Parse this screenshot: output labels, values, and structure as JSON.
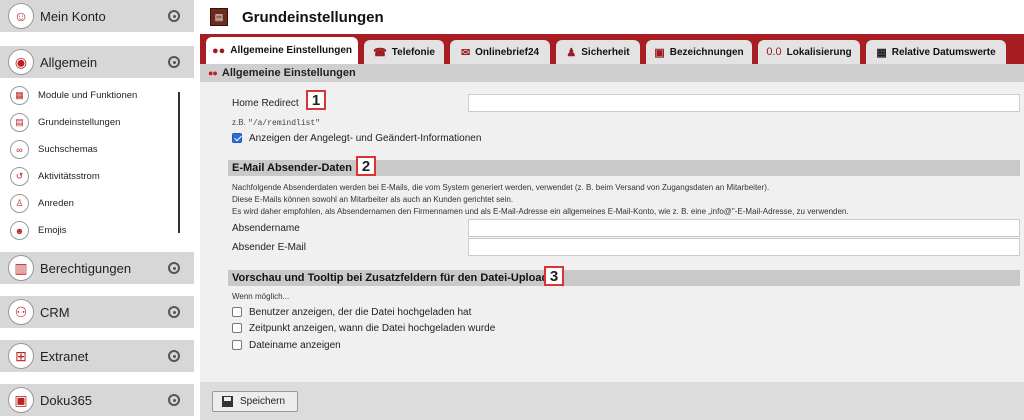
{
  "sidebar": {
    "main_items": [
      {
        "label": "Mein Konto",
        "icon": "user-icon"
      },
      {
        "label": "Allgemein",
        "icon": "disc-icon"
      },
      {
        "label": "Berechtigungen",
        "icon": "books-icon"
      },
      {
        "label": "CRM",
        "icon": "people-icon"
      },
      {
        "label": "Extranet",
        "icon": "network-icon"
      },
      {
        "label": "Doku365",
        "icon": "document-icon"
      }
    ],
    "sub_items": [
      {
        "label": "Module und Funktionen",
        "icon": "modules-icon"
      },
      {
        "label": "Grundeinstellungen",
        "icon": "settings-calendar-icon"
      },
      {
        "label": "Suchschemas",
        "icon": "binoculars-icon"
      },
      {
        "label": "Aktivitätsstrom",
        "icon": "history-icon"
      },
      {
        "label": "Anreden",
        "icon": "person-icon"
      },
      {
        "label": "Emojis",
        "icon": "smiley-icon"
      }
    ]
  },
  "header": {
    "title": "Grundeinstellungen"
  },
  "tabs": [
    {
      "label": "Allgemeine Einstellungen",
      "icon": "dots-icon",
      "active": true
    },
    {
      "label": "Telefonie",
      "icon": "phone-icon"
    },
    {
      "label": "Onlinebrief24",
      "icon": "letter-icon"
    },
    {
      "label": "Sicherheit",
      "icon": "security-icon"
    },
    {
      "label": "Bezeichnungen",
      "icon": "label-icon"
    },
    {
      "label": "Lokalisierung",
      "icon": "locale-icon",
      "icon_text": "0.0"
    },
    {
      "label": "Relative Datumswerte",
      "icon": "calendar-icon"
    }
  ],
  "panel": {
    "title": "Allgemeine Einstellungen",
    "home_redirect": {
      "label": "Home Redirect",
      "value": "",
      "hint_prefix": "z.B. ",
      "hint_code": "\"/a/remindlist\""
    },
    "show_created_changed": {
      "label": "Anzeigen der Angelegt- und Geändert-Informationen",
      "checked": true
    },
    "email_section": {
      "title": "E-Mail Absender-Daten",
      "info_lines": [
        "Nachfolgende Absenderdaten werden bei E-Mails, die vom System generiert werden, verwendet (z. B. beim Versand von Zugangsdaten an Mitarbeiter).",
        "Diese E-Mails können sowohl an Mitarbeiter als auch an Kunden gerichtet sein.",
        "Es wird daher empfohlen, als Absendernamen den Firmennamen und als E-Mail-Adresse ein allgemeines E-Mail-Konto, wie z. B. eine „info@\"-E-Mail-Adresse, zu verwenden."
      ],
      "sender_name": {
        "label": "Absendername",
        "value": ""
      },
      "sender_email": {
        "label": "Absender E-Mail",
        "value": ""
      }
    },
    "preview_section": {
      "title": "Vorschau und Tooltip bei Zusatzfeldern für den Datei-Upload",
      "note": "Wenn möglich...",
      "options": [
        {
          "label": "Benutzer anzeigen, der die Datei hochgeladen hat",
          "checked": false
        },
        {
          "label": "Zeitpunkt anzeigen, wann die Datei hochgeladen wurde",
          "checked": false
        },
        {
          "label": "Dateiname anzeigen",
          "checked": false
        }
      ]
    },
    "markers": [
      "1",
      "2",
      "3"
    ]
  },
  "footer": {
    "save_label": "Speichern"
  },
  "colors": {
    "accent": "#a71d22",
    "panel_bg": "#f0f0f0",
    "section_head": "#c9c9c9",
    "checkbox": "#2a6fd6"
  }
}
